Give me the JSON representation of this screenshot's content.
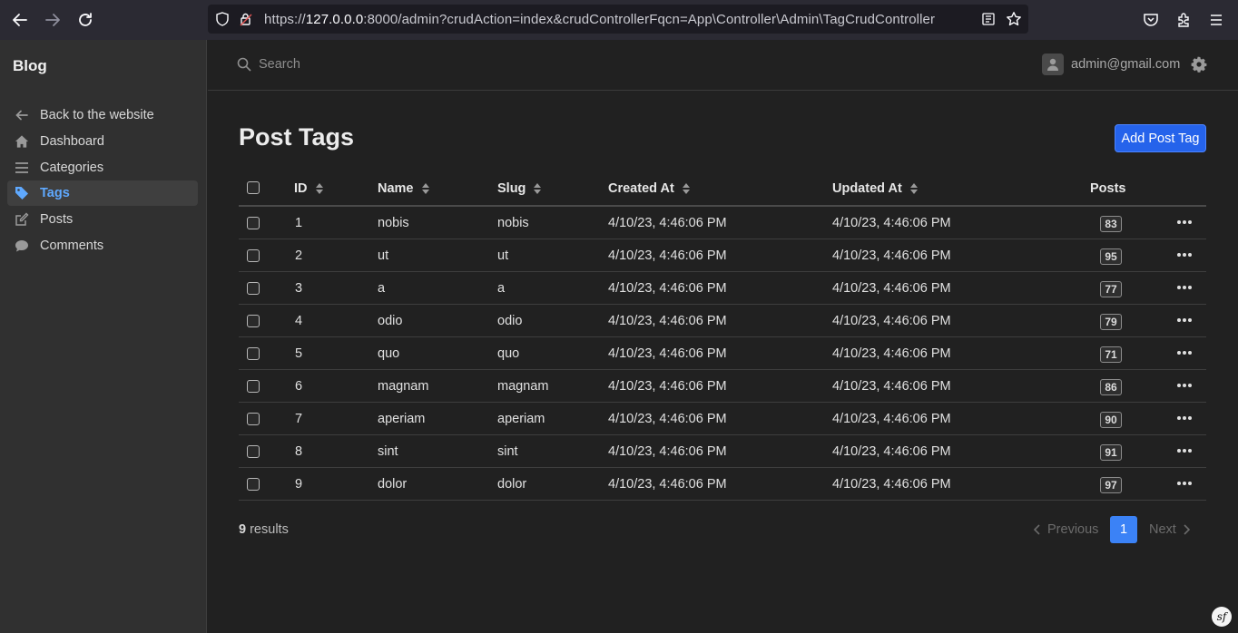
{
  "browser": {
    "url_prefix": "https://",
    "url_host": "127.0.0.0",
    "url_rest": ":8000/admin?crudAction=index&crudControllerFqcn=App\\Controller\\Admin\\TagCrudController"
  },
  "sidebar": {
    "brand": "Blog",
    "items": [
      {
        "label": "Back to the website",
        "icon": "arrow-left-icon"
      },
      {
        "label": "Dashboard",
        "icon": "home-icon"
      },
      {
        "label": "Categories",
        "icon": "list-icon"
      },
      {
        "label": "Tags",
        "icon": "tag-icon",
        "active": true
      },
      {
        "label": "Posts",
        "icon": "edit-icon"
      },
      {
        "label": "Comments",
        "icon": "comment-icon"
      }
    ]
  },
  "header": {
    "search_placeholder": "Search",
    "user_email": "admin@gmail.com"
  },
  "main": {
    "title": "Post Tags",
    "add_button": "Add Post Tag",
    "columns": [
      "ID",
      "Name",
      "Slug",
      "Created At",
      "Updated At",
      "Posts"
    ],
    "rows": [
      {
        "id": "1",
        "name": "nobis",
        "slug": "nobis",
        "created": "4/10/23, 4:46:06 PM",
        "updated": "4/10/23, 4:46:06 PM",
        "posts": "83"
      },
      {
        "id": "2",
        "name": "ut",
        "slug": "ut",
        "created": "4/10/23, 4:46:06 PM",
        "updated": "4/10/23, 4:46:06 PM",
        "posts": "95"
      },
      {
        "id": "3",
        "name": "a",
        "slug": "a",
        "created": "4/10/23, 4:46:06 PM",
        "updated": "4/10/23, 4:46:06 PM",
        "posts": "77"
      },
      {
        "id": "4",
        "name": "odio",
        "slug": "odio",
        "created": "4/10/23, 4:46:06 PM",
        "updated": "4/10/23, 4:46:06 PM",
        "posts": "79"
      },
      {
        "id": "5",
        "name": "quo",
        "slug": "quo",
        "created": "4/10/23, 4:46:06 PM",
        "updated": "4/10/23, 4:46:06 PM",
        "posts": "71"
      },
      {
        "id": "6",
        "name": "magnam",
        "slug": "magnam",
        "created": "4/10/23, 4:46:06 PM",
        "updated": "4/10/23, 4:46:06 PM",
        "posts": "86"
      },
      {
        "id": "7",
        "name": "aperiam",
        "slug": "aperiam",
        "created": "4/10/23, 4:46:06 PM",
        "updated": "4/10/23, 4:46:06 PM",
        "posts": "90"
      },
      {
        "id": "8",
        "name": "sint",
        "slug": "sint",
        "created": "4/10/23, 4:46:06 PM",
        "updated": "4/10/23, 4:46:06 PM",
        "posts": "91"
      },
      {
        "id": "9",
        "name": "dolor",
        "slug": "dolor",
        "created": "4/10/23, 4:46:06 PM",
        "updated": "4/10/23, 4:46:06 PM",
        "posts": "97"
      }
    ],
    "results_count": "9",
    "results_label": " results"
  },
  "pagination": {
    "previous": "Previous",
    "current": "1",
    "next": "Next"
  },
  "colors": {
    "accent": "#2563eb",
    "active_link": "#5fa9ff",
    "background": "#212121",
    "sidebar": "#303030"
  }
}
